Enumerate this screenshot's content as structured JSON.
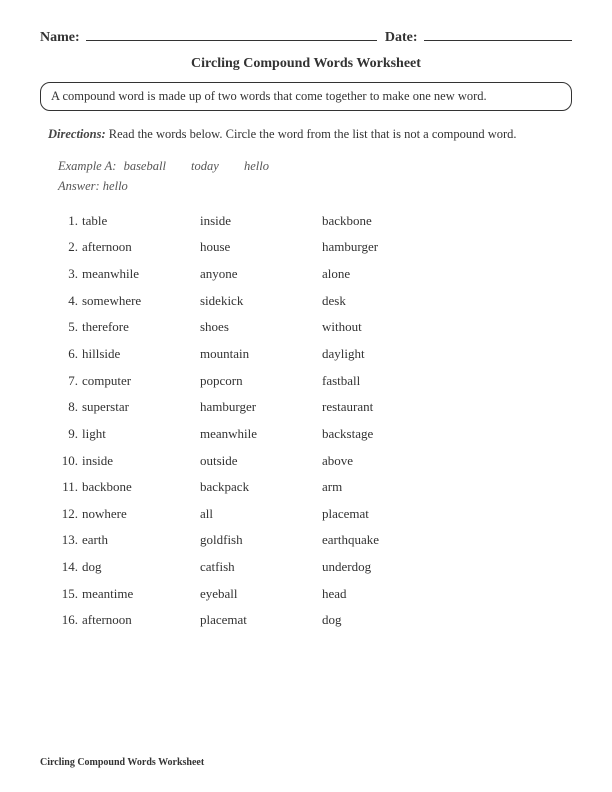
{
  "header": {
    "name_label": "Name:",
    "date_label": "Date:"
  },
  "title": "Circling Compound Words Worksheet",
  "info": "A compound word is made up of two words that come together to make one new word.",
  "directions_label": "Directions:",
  "directions_text": "Read the words below. Circle the word from the list that is not a compound word.",
  "example": {
    "label": "Example A:",
    "w1": "baseball",
    "w2": "today",
    "w3": "hello",
    "answer_label": "Answer:",
    "answer": "hello"
  },
  "rows": [
    {
      "n": "1.",
      "a": "table",
      "b": "inside",
      "c": "backbone"
    },
    {
      "n": "2.",
      "a": "afternoon",
      "b": "house",
      "c": "hamburger"
    },
    {
      "n": "3.",
      "a": "meanwhile",
      "b": "anyone",
      "c": "alone"
    },
    {
      "n": "4.",
      "a": "somewhere",
      "b": "sidekick",
      "c": "desk"
    },
    {
      "n": "5.",
      "a": "therefore",
      "b": "shoes",
      "c": "without"
    },
    {
      "n": "6.",
      "a": "hillside",
      "b": "mountain",
      "c": "daylight"
    },
    {
      "n": "7.",
      "a": "computer",
      "b": "popcorn",
      "c": "fastball"
    },
    {
      "n": "8.",
      "a": "superstar",
      "b": "hamburger",
      "c": "restaurant"
    },
    {
      "n": "9.",
      "a": "light",
      "b": "meanwhile",
      "c": "backstage"
    },
    {
      "n": "10.",
      "a": "inside",
      "b": "outside",
      "c": "above"
    },
    {
      "n": "11.",
      "a": "backbone",
      "b": "backpack",
      "c": "arm"
    },
    {
      "n": "12.",
      "a": "nowhere",
      "b": "all",
      "c": "placemat"
    },
    {
      "n": "13.",
      "a": "earth",
      "b": "goldfish",
      "c": "earthquake"
    },
    {
      "n": "14.",
      "a": "dog",
      "b": "catfish",
      "c": "underdog"
    },
    {
      "n": "15.",
      "a": "meantime",
      "b": "eyeball",
      "c": "head"
    },
    {
      "n": "16.",
      "a": "afternoon",
      "b": "placemat",
      "c": "dog"
    }
  ],
  "footer": "Circling Compound Words Worksheet"
}
